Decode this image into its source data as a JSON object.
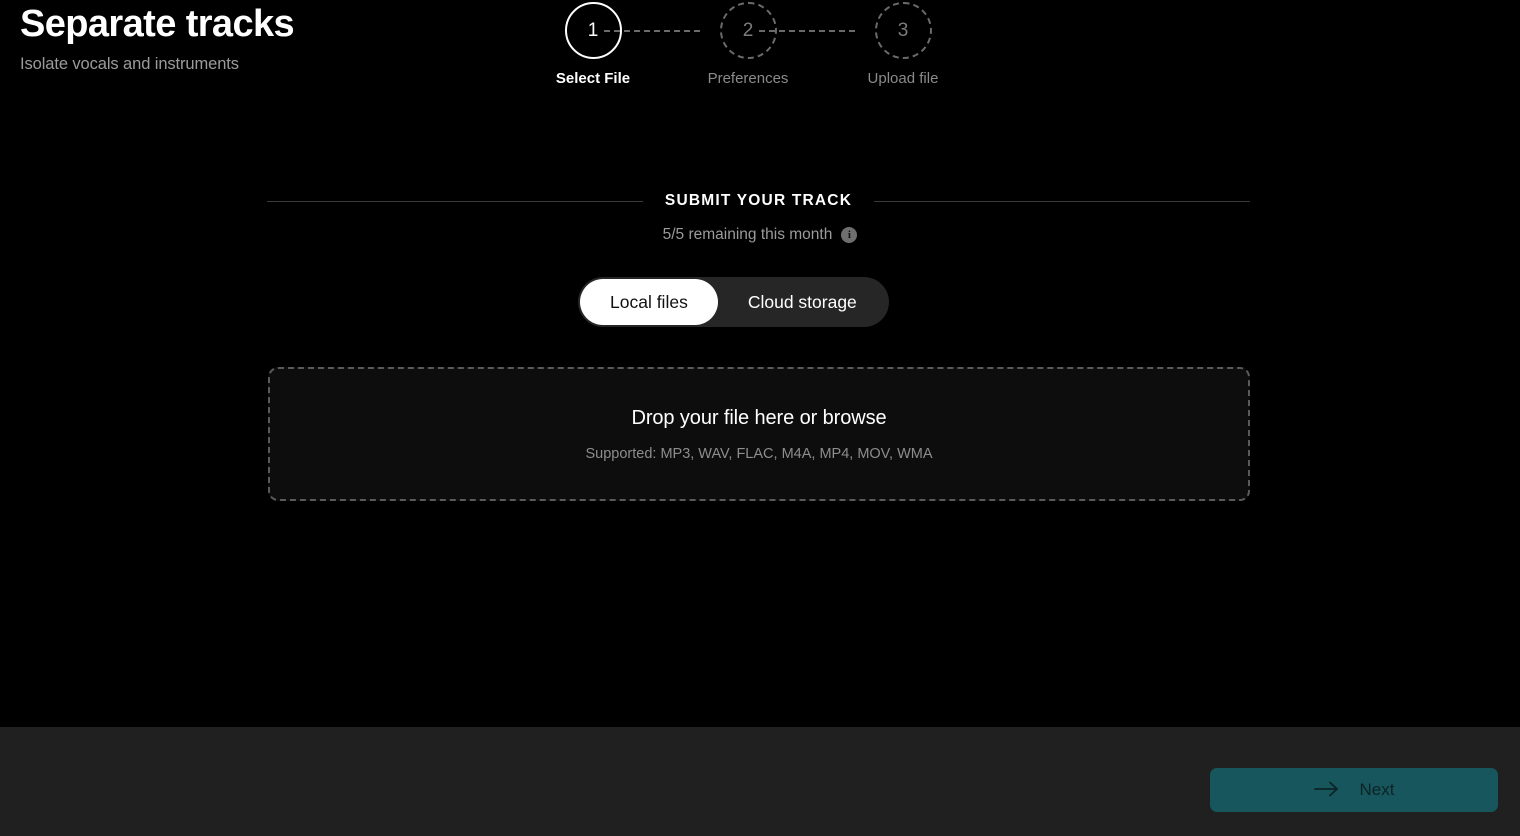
{
  "header": {
    "title": "Separate tracks",
    "subtitle": "Isolate vocals and instruments"
  },
  "stepper": {
    "steps": [
      {
        "number": "1",
        "label": "Select File",
        "state": "active"
      },
      {
        "number": "2",
        "label": "Preferences",
        "state": "inactive"
      },
      {
        "number": "3",
        "label": "Upload file",
        "state": "inactive"
      }
    ]
  },
  "main": {
    "section_heading": "SUBMIT YOUR TRACK",
    "quota_text": "5/5 remaining this month",
    "info_icon_glyph": "i",
    "source_toggle": {
      "options": [
        {
          "label": "Local files",
          "selected": true
        },
        {
          "label": "Cloud storage",
          "selected": false
        }
      ]
    },
    "dropzone": {
      "title": "Drop your file here or browse",
      "supported": "Supported: MP3, WAV, FLAC, M4A, MP4, MOV, WMA"
    }
  },
  "footer": {
    "next_label": "Next",
    "next_icon": "arrow-right-icon"
  },
  "colors": {
    "background": "#000000",
    "footer_background": "#202020",
    "accent_teal": "#16565c",
    "toggle_track": "#262626",
    "toggle_selected": "#ffffff",
    "muted_text": "#9b9b9b",
    "divider": "#3b3b3b",
    "dashed_border": "#5a5a5a"
  }
}
